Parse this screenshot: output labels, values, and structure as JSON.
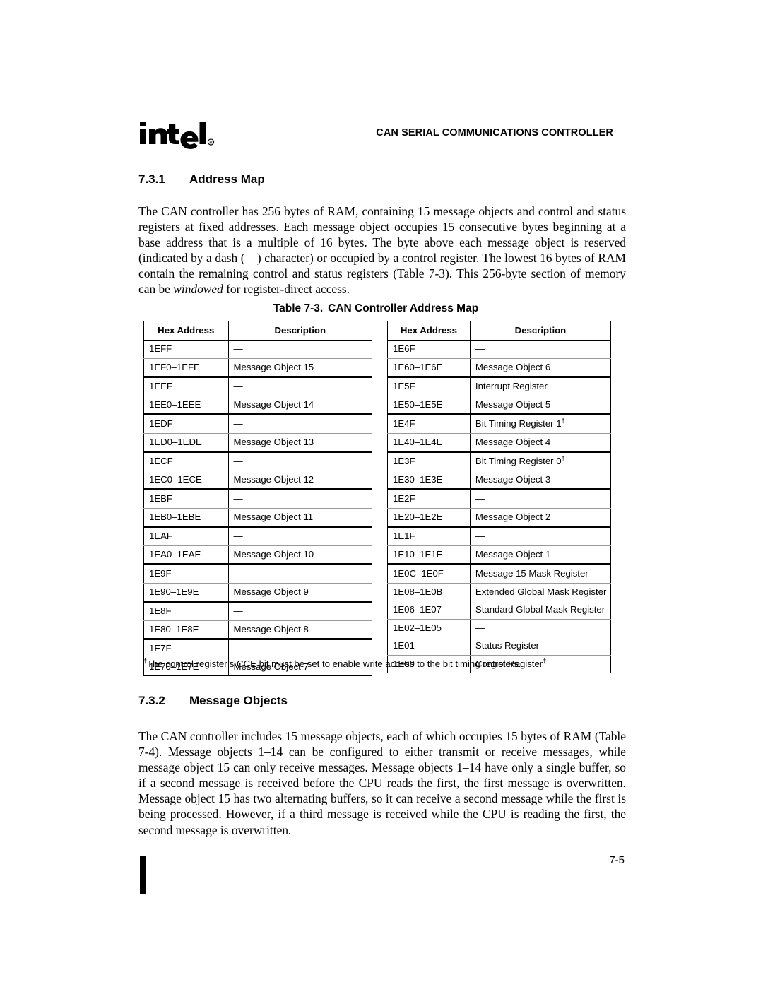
{
  "header": {
    "logo_text": "intel",
    "logo_registered": "®",
    "title": "CAN SERIAL COMMUNICATIONS CONTROLLER"
  },
  "sections": [
    {
      "number": "7.3.1",
      "title": "Address Map",
      "paragraph": "The CAN controller has 256 bytes of RAM, containing 15 message objects and control and status registers at fixed addresses. Each message object occupies 15 consecutive bytes beginning at a base address that is a multiple of 16 bytes. The byte above each message object is reserved (indicated by a dash (—) character) or occupied by a control register. The lowest 16 bytes of RAM contain the remaining control and status registers (Table 7-3). This 256-byte section of memory can be windowed for register-direct access."
    },
    {
      "number": "7.3.2",
      "title": "Message Objects",
      "paragraph": "The CAN controller includes 15 message objects, each of which occupies 15 bytes of RAM (Table 7-4). Message objects 1–14 can be configured to either transmit or receive messages, while message object 15 can only receive messages. Message objects 1–14 have only a single buffer, so if a second message is received before the CPU reads the first, the first message is overwritten. Message object 15 has two alternating buffers, so it can receive a second message while the first is being processed. However, if a third message is received while the CPU is reading the first, the second message is overwritten."
    }
  ],
  "table": {
    "caption_number": "Table 7-3.",
    "caption_title": "CAN Controller Address Map",
    "columns": [
      "Hex Address",
      "Description"
    ],
    "left_rows": [
      {
        "address": "1EFF",
        "description": "—",
        "sep": "thin"
      },
      {
        "address": "1EF0–1EFE",
        "description": "Message Object 15",
        "sep": "thick"
      },
      {
        "address": "1EEF",
        "description": "—",
        "sep": "thin"
      },
      {
        "address": "1EE0–1EEE",
        "description": "Message Object 14",
        "sep": "thick"
      },
      {
        "address": "1EDF",
        "description": "—",
        "sep": "thin"
      },
      {
        "address": "1ED0–1EDE",
        "description": "Message Object 13",
        "sep": "thick"
      },
      {
        "address": "1ECF",
        "description": "—",
        "sep": "thin"
      },
      {
        "address": "1EC0–1ECE",
        "description": "Message Object 12",
        "sep": "thick"
      },
      {
        "address": "1EBF",
        "description": "—",
        "sep": "thin"
      },
      {
        "address": "1EB0–1EBE",
        "description": "Message Object 11",
        "sep": "thick"
      },
      {
        "address": "1EAF",
        "description": "—",
        "sep": "thin"
      },
      {
        "address": "1EA0–1EAE",
        "description": "Message Object 10",
        "sep": "thick"
      },
      {
        "address": "1E9F",
        "description": "—",
        "sep": "thin"
      },
      {
        "address": "1E90–1E9E",
        "description": "Message Object 9",
        "sep": "thick"
      },
      {
        "address": "1E8F",
        "description": "—",
        "sep": "thin"
      },
      {
        "address": "1E80–1E8E",
        "description": "Message Object 8",
        "sep": "thick"
      },
      {
        "address": "1E7F",
        "description": "—",
        "sep": "thin"
      },
      {
        "address": "1E70–1E7E",
        "description": "Message Object 7",
        "sep": "last"
      }
    ],
    "right_rows": [
      {
        "address": "1E6F",
        "description": "—",
        "sep": "thin"
      },
      {
        "address": "1E60–1E6E",
        "description": "Message Object 6",
        "sep": "thick"
      },
      {
        "address": "1E5F",
        "description": "Interrupt Register",
        "sep": "thin"
      },
      {
        "address": "1E50–1E5E",
        "description": "Message Object 5",
        "sep": "thick"
      },
      {
        "address": "1E4F",
        "description": "Bit Timing Register 1",
        "dagger": true,
        "sep": "thin"
      },
      {
        "address": "1E40–1E4E",
        "description": "Message Object 4",
        "sep": "thick"
      },
      {
        "address": "1E3F",
        "description": "Bit Timing Register 0",
        "dagger": true,
        "sep": "thin"
      },
      {
        "address": "1E30–1E3E",
        "description": "Message Object 3",
        "sep": "thick"
      },
      {
        "address": "1E2F",
        "description": "—",
        "sep": "thin"
      },
      {
        "address": "1E20–1E2E",
        "description": "Message Object 2",
        "sep": "thick"
      },
      {
        "address": "1E1F",
        "description": "—",
        "sep": "thin"
      },
      {
        "address": "1E10–1E1E",
        "description": "Message Object 1",
        "sep": "thick"
      },
      {
        "address": "1E0C–1E0F",
        "description": "Message 15 Mask Register",
        "sep": "thin"
      },
      {
        "address": "1E08–1E0B",
        "description": "Extended Global Mask Register",
        "sep": "thin"
      },
      {
        "address": "1E06–1E07",
        "description": "Standard Global Mask Register",
        "sep": "thin"
      },
      {
        "address": "1E02–1E05",
        "description": "—",
        "sep": "thin"
      },
      {
        "address": "1E01",
        "description": "Status Register",
        "sep": "thin"
      },
      {
        "address": "1E00",
        "description": "Control Register",
        "dagger": true,
        "sep": "last"
      }
    ],
    "footnote_marker": "†",
    "footnote": "The control register’s CCE bit must be set to enable write access to the bit timing registers."
  },
  "footer": {
    "page_number": "7-5"
  }
}
